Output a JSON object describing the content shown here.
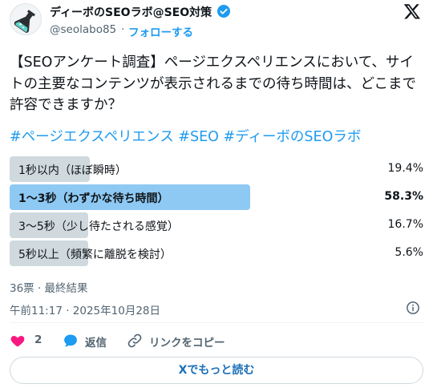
{
  "header": {
    "author_name": "ディーボのSEOラボ@SEO対策",
    "handle": "@seolabo85",
    "separator": "·",
    "follow_label": "フォローする"
  },
  "tweet": {
    "text": "【SEOアンケート調査】ページエクスペリエンスにおいて、サイトの主要なコンテンツが表示されるまでの待ち時間は、どこまで許容できますか？",
    "hashtags": [
      "#ページエクスペリエンス",
      "#SEO",
      "#ディーボのSEOラボ"
    ]
  },
  "poll": {
    "options": [
      {
        "label": "1秒以内（ほぼ瞬時）",
        "percent": "19.4%",
        "fraction": 0.194,
        "winner": false
      },
      {
        "label": "1〜3秒（わずかな待ち時間）",
        "percent": "58.3%",
        "fraction": 0.583,
        "winner": true
      },
      {
        "label": "3〜5秒（少し待たされる感覚）",
        "percent": "16.7%",
        "fraction": 0.167,
        "winner": false
      },
      {
        "label": "5秒以上（頻繁に離脱を検討）",
        "percent": "5.6%",
        "fraction": 0.056,
        "winner": false
      }
    ],
    "votes_line": "36票 · 最終結果"
  },
  "timestamp": "午前11:17 · 2025年10月28日",
  "actions": {
    "likes": "2",
    "reply_label": "返信",
    "copy_link_label": "リンクをコピー"
  },
  "read_more_label": "Xでもっと読む",
  "colors": {
    "accent": "#1d9bf0",
    "winner_bar": "#8ec9f4",
    "bar": "#cfd9de",
    "like": "#f91880",
    "secondary_text": "#536471"
  },
  "icons": [
    "avatar-flask-icon",
    "verified-badge-icon",
    "x-logo-icon",
    "info-icon",
    "heart-icon",
    "reply-bubble-icon",
    "link-icon"
  ]
}
